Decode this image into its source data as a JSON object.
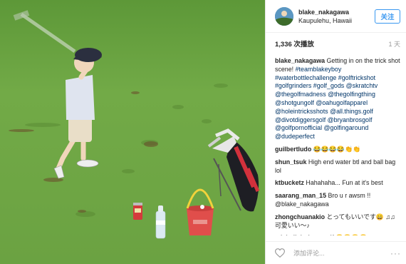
{
  "header": {
    "username": "blake_nakagawa",
    "location": "Kaupulehu, Hawaii",
    "follow_label": "关注"
  },
  "stats": {
    "views": "1,336 次播放",
    "age": "1 天"
  },
  "caption": {
    "user": "blake_nakagawa",
    "text": "Getting in on the trick shot scene!",
    "hashtags": "#teamblakeyboy #waterbottlechallenge #golftrickshot #golfgrinders #golf_gods @skratchtv @thegolfmadness @thegolfingthing @shotgungolf @oahugolfapparel @holeintricksshots @all.things.golf @divotdiggersgolf @bryanbrosgolf @golfpornofficial @golfingaround @dudeperfect"
  },
  "comments": [
    {
      "user": "guilbertludo",
      "text": "😂😂😂😂👏👏"
    },
    {
      "user": "shun_tsuk",
      "text": "High end water btl and ball bag lol"
    },
    {
      "user": "ktbucketz",
      "text": "Hahahaha... Fun at it's best"
    },
    {
      "user": "saarang_man_15",
      "text": "Bro u r awsm !! @blake_nakagawa"
    },
    {
      "user": "zhongchuanakio",
      "text": "とってもいいです😄 ♫♫ 可愛いい～♪"
    },
    {
      "user": "michelleholmesgolf",
      "text": "😍😍😍😍"
    }
  ],
  "footer": {
    "add_comment_placeholder": "添加评论...",
    "more_label": "···"
  },
  "colors": {
    "link": "#003569",
    "accent": "#3897f0",
    "grass": "#78b04c"
  }
}
